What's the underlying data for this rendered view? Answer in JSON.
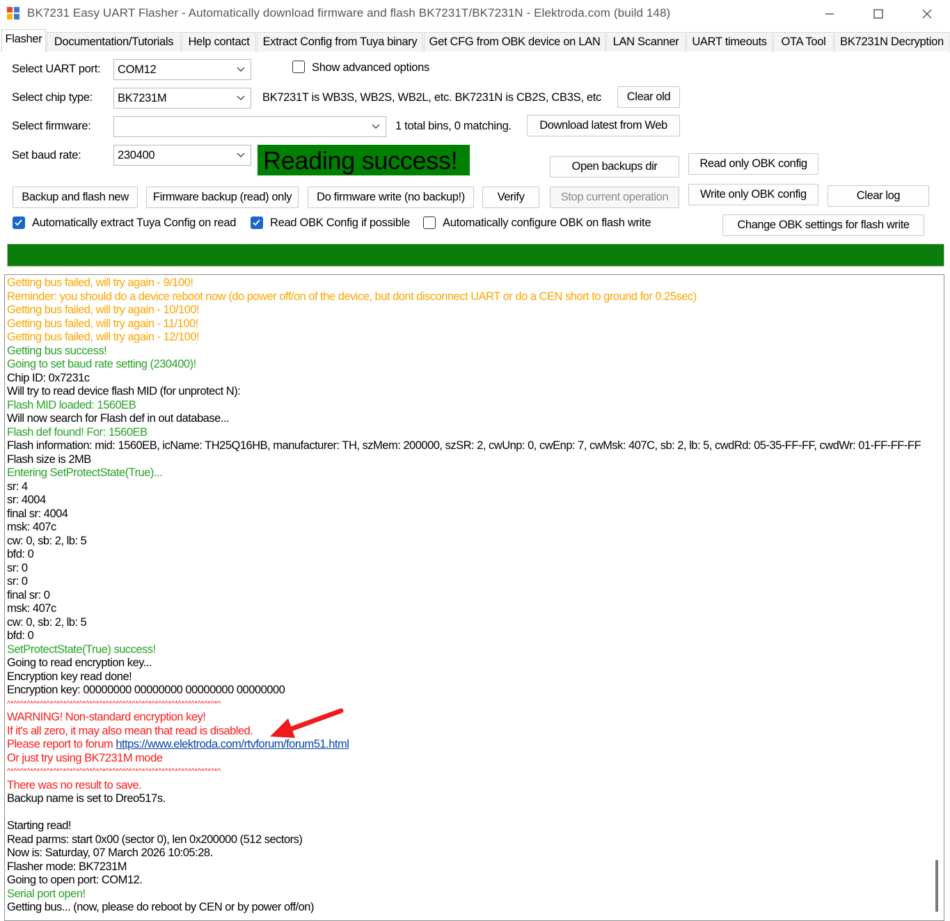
{
  "window": {
    "title": "BK7231 Easy UART Flasher - Automatically download firmware and flash BK7231T/BK7231N  - Elektroda.com (build 148)",
    "minimize_glyph": "—",
    "maximize_glyph": "☐",
    "close_glyph": "✕"
  },
  "tabs": [
    "Flasher",
    "Documentation/Tutorials",
    "Help contact",
    "Extract Config from Tuya binary",
    "Get CFG from OBK device on LAN",
    "LAN Scanner",
    "UART timeouts",
    "OTA Tool",
    "BK7231N Decryption"
  ],
  "form": {
    "uart_port_label": "Select UART port:",
    "uart_port_value": "COM12",
    "show_advanced_label": "Show advanced options",
    "chip_type_label": "Select chip type:",
    "chip_type_value": "BK7231M",
    "chip_info": "BK7231T is WB3S, WB2S, WB2L, etc. BK7231N is CB2S, CB3S, etc",
    "clear_old": "Clear old",
    "firmware_label": "Select firmware:",
    "firmware_value": "",
    "firmware_info": "1 total bins, 0 matching.",
    "download_latest": "Download latest from Web",
    "baud_label": "Set baud rate:",
    "baud_value": "230400",
    "status_text": "Reading success!",
    "open_backups": "Open backups dir",
    "read_obk_config": "Read only OBK config",
    "write_obk_config": "Write only OBK config",
    "backup_flash_new": "Backup and flash new",
    "firmware_backup_only": "Firmware backup (read) only",
    "firmware_write": "Do firmware write (no backup!)",
    "verify": "Verify",
    "stop_operation": "Stop current operation",
    "clear_log": "Clear log",
    "auto_extract_label": "Automatically extract Tuya Config on read",
    "read_obk_if_possible_label": "Read OBK Config if possible",
    "auto_configure_label": "Automatically configure OBK on flash write",
    "change_obk_settings": "Change OBK settings for flash write"
  },
  "checkboxes": {
    "show_advanced": false,
    "auto_extract": true,
    "read_obk_if_possible": true,
    "auto_configure": false
  },
  "progress": {
    "value": 1.0
  },
  "colors": {
    "status_bg": "#008000",
    "progress": "#0a7d0a",
    "log_orange": "#ffa500",
    "log_green": "#27a327",
    "log_red": "#ff1a1a",
    "checkbox_blue": "#1a67c9"
  },
  "log": [
    {
      "c": "orange",
      "t": "Getting bus failed, will try again - 9/100!"
    },
    {
      "c": "orange",
      "t": "Reminder: you should do a device reboot now (do power off/on of the device, but dont disconnect UART or do a CEN short to ground for 0.25sec)"
    },
    {
      "c": "orange",
      "t": "Getting bus failed, will try again - 10/100!"
    },
    {
      "c": "orange",
      "t": "Getting bus failed, will try again - 11/100!"
    },
    {
      "c": "orange",
      "t": "Getting bus failed, will try again - 12/100!"
    },
    {
      "c": "green",
      "t": "Getting bus success!"
    },
    {
      "c": "green",
      "t": "Going to set baud rate setting (230400)!"
    },
    {
      "c": "black",
      "t": "Chip ID: 0x7231c"
    },
    {
      "c": "black",
      "t": "Will try to read device flash MID (for unprotect N):"
    },
    {
      "c": "green",
      "t": "Flash MID loaded: 1560EB"
    },
    {
      "c": "black",
      "t": "Will now search for Flash def in out database..."
    },
    {
      "c": "green",
      "t": "Flash def found! For: 1560EB"
    },
    {
      "c": "black",
      "t": "Flash information: mid: 1560EB, icName: TH25Q16HB, manufacturer: TH, szMem: 200000, szSR: 2, cwUnp: 0, cwEnp: 7, cwMsk: 407C, sb: 2, lb: 5, cwdRd: 05-35-FF-FF, cwdWr: 01-FF-FF-FF"
    },
    {
      "c": "black",
      "t": "Flash size is 2MB"
    },
    {
      "c": "green",
      "t": "Entering SetProtectState(True)..."
    },
    {
      "c": "black",
      "t": "sr: 4"
    },
    {
      "c": "black",
      "t": "sr: 4004"
    },
    {
      "c": "black",
      "t": "final sr: 4004"
    },
    {
      "c": "black",
      "t": "msk: 407c"
    },
    {
      "c": "black",
      "t": "cw: 0, sb: 2, lb: 5"
    },
    {
      "c": "black",
      "t": "bfd: 0"
    },
    {
      "c": "black",
      "t": "sr: 0"
    },
    {
      "c": "black",
      "t": "sr: 0"
    },
    {
      "c": "black",
      "t": "final sr: 0"
    },
    {
      "c": "black",
      "t": "msk: 407c"
    },
    {
      "c": "black",
      "t": "cw: 0, sb: 2, lb: 5"
    },
    {
      "c": "black",
      "t": "bfd: 0"
    },
    {
      "c": "green",
      "t": "SetProtectState(True) success!"
    },
    {
      "c": "black",
      "t": "Going to read encryption key..."
    },
    {
      "c": "black",
      "t": "Encryption key read done!"
    },
    {
      "c": "black",
      "t": "Encryption key: 00000000 00000000 00000000 00000000"
    },
    {
      "c": "caret",
      "t": "^*^*^*^*^*^*^*^*^*^*^*^*^*^*^*^*^*^*^*^*^*^*^*^*^*^*^*^*^*^*^*^*^"
    },
    {
      "c": "red",
      "t": "WARNING! Non-standard encryption key!"
    },
    {
      "c": "red",
      "t": "If it's all zero, it may also mean that read is disabled."
    },
    {
      "c": "red",
      "t": "Please report to forum ",
      "link": "https://www.elektroda.com/rtvforum/forum51.html"
    },
    {
      "c": "red",
      "t": "Or just try using BK7231M mode"
    },
    {
      "c": "caret",
      "t": "^*^*^*^*^*^*^*^*^*^*^*^*^*^*^*^*^*^*^*^*^*^*^*^*^*^*^*^*^*^*^*^*^"
    },
    {
      "c": "red",
      "t": "There was no result to save."
    },
    {
      "c": "black",
      "t": "Backup name is set to Dreo517s."
    },
    {
      "c": "black",
      "t": ""
    },
    {
      "c": "black",
      "t": "Starting read!"
    },
    {
      "c": "black",
      "t": "Read parms: start 0x00 (sector 0), len 0x200000 (512 sectors)"
    },
    {
      "c": "black",
      "t": "Now is: Saturday, 07 March 2026 10:05:28."
    },
    {
      "c": "black",
      "t": "Flasher mode: BK7231M"
    },
    {
      "c": "black",
      "t": "Going to open port: COM12."
    },
    {
      "c": "green",
      "t": "Serial port open!"
    },
    {
      "c": "black",
      "t": "Getting bus... (now, please do reboot by CEN or by power off/on)"
    }
  ]
}
